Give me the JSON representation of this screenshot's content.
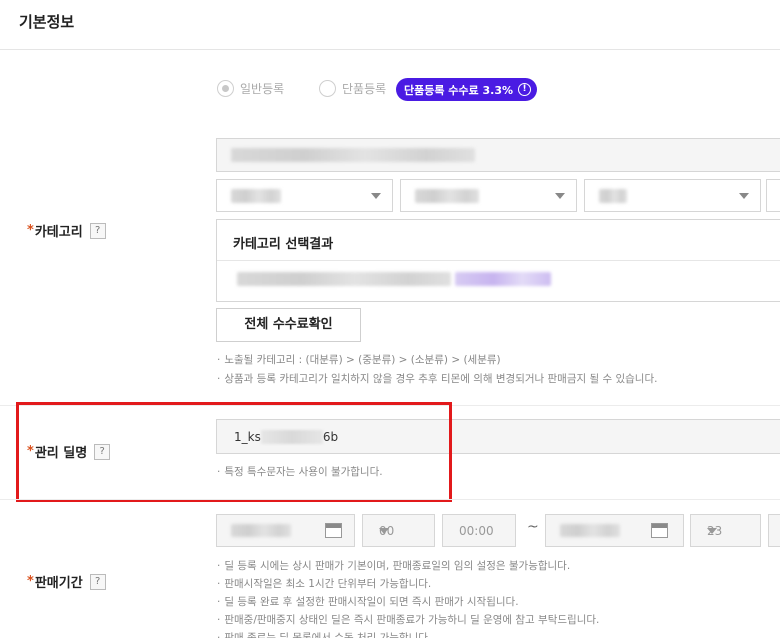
{
  "header": {
    "title": "기본정보"
  },
  "registration": {
    "option_general": "일반등록",
    "option_single": "단품등록",
    "badge": "단품등록 수수료 3.3%",
    "badge_icon": "exclamation-circle-icon"
  },
  "category": {
    "label": "카테고리",
    "help": "?",
    "result_title": "카테고리 선택결과",
    "fee_button": "전체 수수료확인",
    "notes": [
      "노출될 카테고리 : (대분류) > (중분류) > (소분류) > (세분류)",
      "상품과 등록 카테고리가 일치하지 않을 경우 추후 티몬에 의해 변경되거나 판매금지 될 수 있습니다."
    ]
  },
  "manage_name": {
    "label": "관리 딜명",
    "help": "?",
    "value_prefix": "1_ks",
    "value_suffix": "6b",
    "note": "특정 특수문자는 사용이 불가합니다."
  },
  "sale_period": {
    "label": "판매기간",
    "help": "?",
    "start_hour": "00",
    "start_minute": "00:00",
    "separator": "~",
    "end_hour": "23",
    "notes": [
      "딜 등록 시에는 상시 판매가 기본이며, 판매종료일의 임의 설정은 불가능합니다.",
      "판매시작일은 최소 1시간 단위부터 가능합니다.",
      "딜 등록 완료 후 설정한 판매시작일이 되면 즉시 판매가 시작됩니다.",
      "판매중/판매중지 상태인 딜은 즉시 판매종료가 가능하니 딜 운영에 참고 부탁드립니다.",
      "판매 종료는 딜 목록에서 수동 처리 가능합니다."
    ]
  },
  "colors": {
    "accent": "#4a1be3",
    "required_star": "#d9501c",
    "highlight": "#e2191b"
  }
}
